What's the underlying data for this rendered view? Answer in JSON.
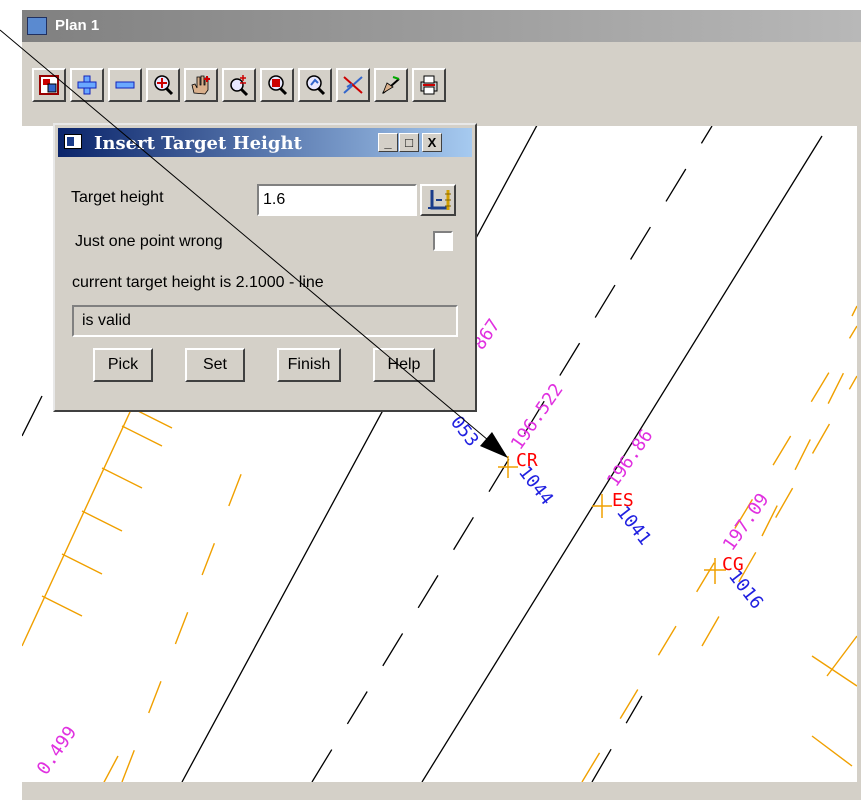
{
  "window": {
    "title": "Plan 1",
    "toolbar_icons": [
      "views-icon",
      "zoom-in-icon",
      "zoom-out-icon",
      "centre-zoom-icon",
      "pan-icon",
      "zoom-plus-minus-icon",
      "zoom-window-icon",
      "zoom-previous-icon",
      "cross-section-icon",
      "pick-icon",
      "print-icon"
    ]
  },
  "dialog": {
    "title": "Insert Target Height",
    "target_height_label": "Target height",
    "target_height_value": "1.6",
    "just_one_point_label": "Just one point wrong",
    "current_target_text": "current target height is 2.1000 - line",
    "status_text": "is valid",
    "buttons": {
      "pick": "Pick",
      "set": "Set",
      "finish": "Finish",
      "help": "Help"
    },
    "window_buttons": {
      "minimize": "_",
      "maximize": "□",
      "close": "X"
    }
  },
  "plan": {
    "points": [
      {
        "code": "CR",
        "height": "196.522",
        "id": "1044"
      },
      {
        "code": "ES",
        "height": "196.86",
        "id": "1041"
      },
      {
        "code": "CG",
        "height": "197.09",
        "id": "1016"
      }
    ],
    "partial_labels": {
      "height_867": "867",
      "id_053": "053",
      "height_499": "0.499"
    },
    "colors": {
      "line": "#000000",
      "batter": "#f0a000",
      "height_text": "#e030e0",
      "id_text": "#2020e0",
      "code_text": "#ff0000"
    }
  }
}
